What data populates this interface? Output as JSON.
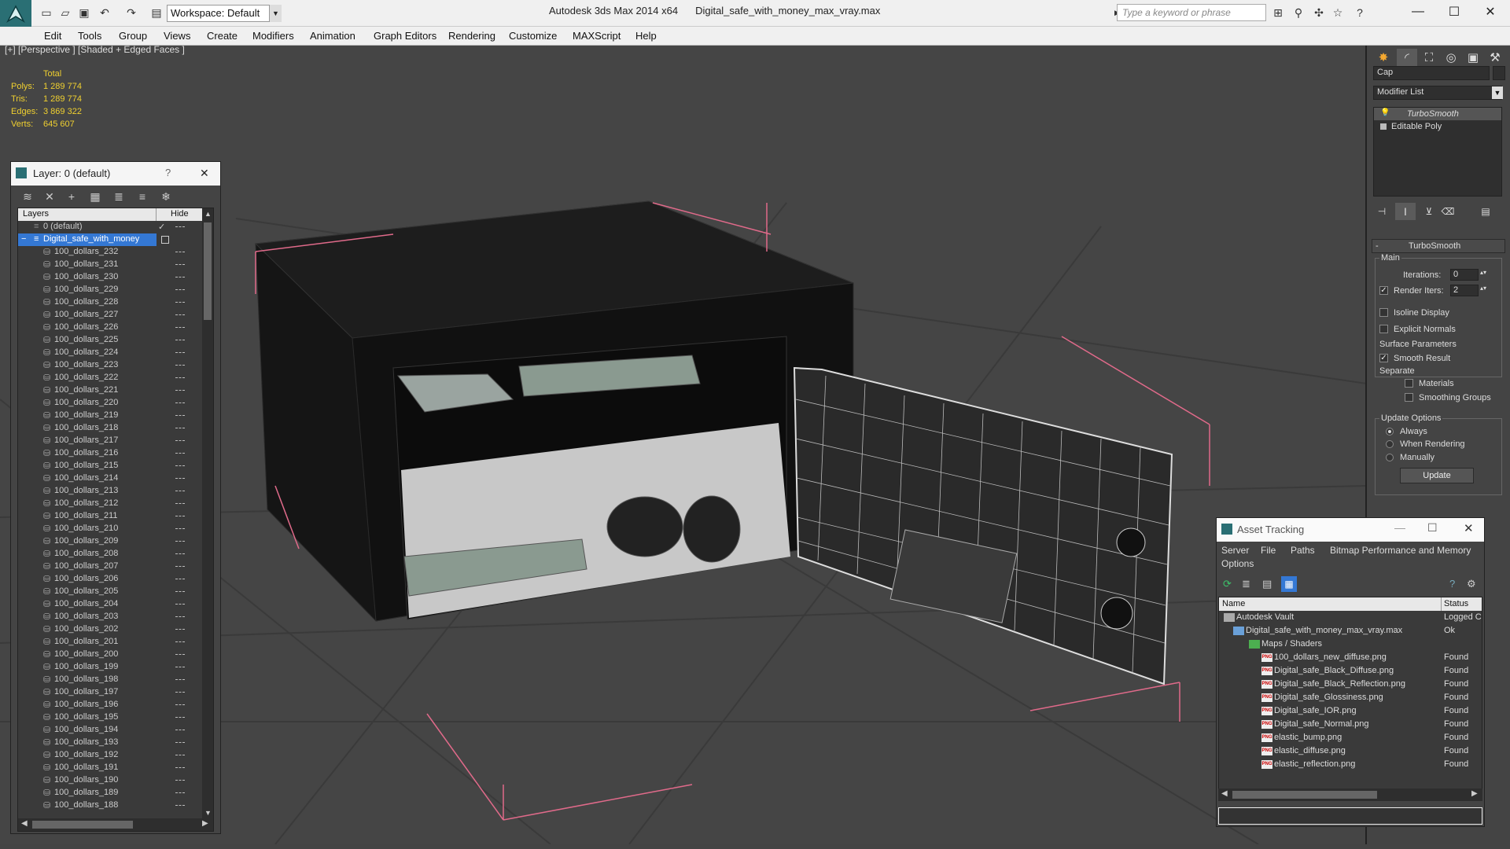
{
  "app": {
    "title": "Autodesk 3ds Max  2014 x64",
    "file": "Digital_safe_with_money_max_vray.max",
    "workspace": "Workspace: Default",
    "search_placeholder": "Type a keyword or phrase"
  },
  "menu": [
    "Edit",
    "Tools",
    "Group",
    "Views",
    "Create",
    "Modifiers",
    "Animation",
    "Graph Editors",
    "Rendering",
    "Customize",
    "MAXScript",
    "Help"
  ],
  "viewport": {
    "label": "[+] [Perspective ] [Shaded + Edged Faces ]",
    "stats": {
      "header": "Total",
      "rows": [
        {
          "k": "Polys:",
          "v": "1 289 774"
        },
        {
          "k": "Tris:",
          "v": "1 289 774"
        },
        {
          "k": "Edges:",
          "v": "3 869 322"
        },
        {
          "k": "Verts:",
          "v": "645 607"
        }
      ]
    }
  },
  "layer_panel": {
    "title": "Layer: 0 (default)",
    "help": "?",
    "close": "✕",
    "col_layers": "Layers",
    "col_hide": "Hide",
    "default_layer": "0 (default)",
    "selected_layer": "Digital_safe_with_money",
    "items": [
      "100_dollars_232",
      "100_dollars_231",
      "100_dollars_230",
      "100_dollars_229",
      "100_dollars_228",
      "100_dollars_227",
      "100_dollars_226",
      "100_dollars_225",
      "100_dollars_224",
      "100_dollars_223",
      "100_dollars_222",
      "100_dollars_221",
      "100_dollars_220",
      "100_dollars_219",
      "100_dollars_218",
      "100_dollars_217",
      "100_dollars_216",
      "100_dollars_215",
      "100_dollars_214",
      "100_dollars_213",
      "100_dollars_212",
      "100_dollars_211",
      "100_dollars_210",
      "100_dollars_209",
      "100_dollars_208",
      "100_dollars_207",
      "100_dollars_206",
      "100_dollars_205",
      "100_dollars_204",
      "100_dollars_203",
      "100_dollars_202",
      "100_dollars_201",
      "100_dollars_200",
      "100_dollars_199",
      "100_dollars_198",
      "100_dollars_197",
      "100_dollars_196",
      "100_dollars_195",
      "100_dollars_194",
      "100_dollars_193",
      "100_dollars_192",
      "100_dollars_191",
      "100_dollars_190",
      "100_dollars_189",
      "100_dollars_188"
    ]
  },
  "command_panel": {
    "object_name": "Cap",
    "modifier_list": "Modifier List",
    "stack": [
      "TurboSmooth",
      "Editable Poly"
    ],
    "rollout_title": "TurboSmooth",
    "main": "Main",
    "iterations_label": "Iterations:",
    "iterations_value": "0",
    "render_iters_label": "Render Iters:",
    "render_iters_value": "2",
    "isoline": "Isoline Display",
    "explicit": "Explicit Normals",
    "surface_params": "Surface Parameters",
    "smooth_result": "Smooth Result",
    "separate": "Separate",
    "materials": "Materials",
    "smoothing_groups": "Smoothing Groups",
    "update_options": "Update Options",
    "always": "Always",
    "when_rendering": "When Rendering",
    "manually": "Manually",
    "update_btn": "Update"
  },
  "asset_tracking": {
    "title": "Asset Tracking",
    "menu": [
      "Server",
      "File",
      "Paths",
      "Bitmap Performance and Memory"
    ],
    "menu2": "Options",
    "col_name": "Name",
    "col_status": "Status",
    "rows": [
      {
        "name": "Autodesk Vault",
        "status": "Logged C"
      },
      {
        "name": "Digital_safe_with_money_max_vray.max",
        "status": "Ok"
      },
      {
        "name": "Maps / Shaders",
        "status": ""
      },
      {
        "name": "100_dollars_new_diffuse.png",
        "status": "Found"
      },
      {
        "name": "Digital_safe_Black_Diffuse.png",
        "status": "Found"
      },
      {
        "name": "Digital_safe_Black_Reflection.png",
        "status": "Found"
      },
      {
        "name": "Digital_safe_Glossiness.png",
        "status": "Found"
      },
      {
        "name": "Digital_safe_IOR.png",
        "status": "Found"
      },
      {
        "name": "Digital_safe_Normal.png",
        "status": "Found"
      },
      {
        "name": "elastic_bump.png",
        "status": "Found"
      },
      {
        "name": "elastic_diffuse.png",
        "status": "Found"
      },
      {
        "name": "elastic_reflection.png",
        "status": "Found"
      }
    ]
  }
}
